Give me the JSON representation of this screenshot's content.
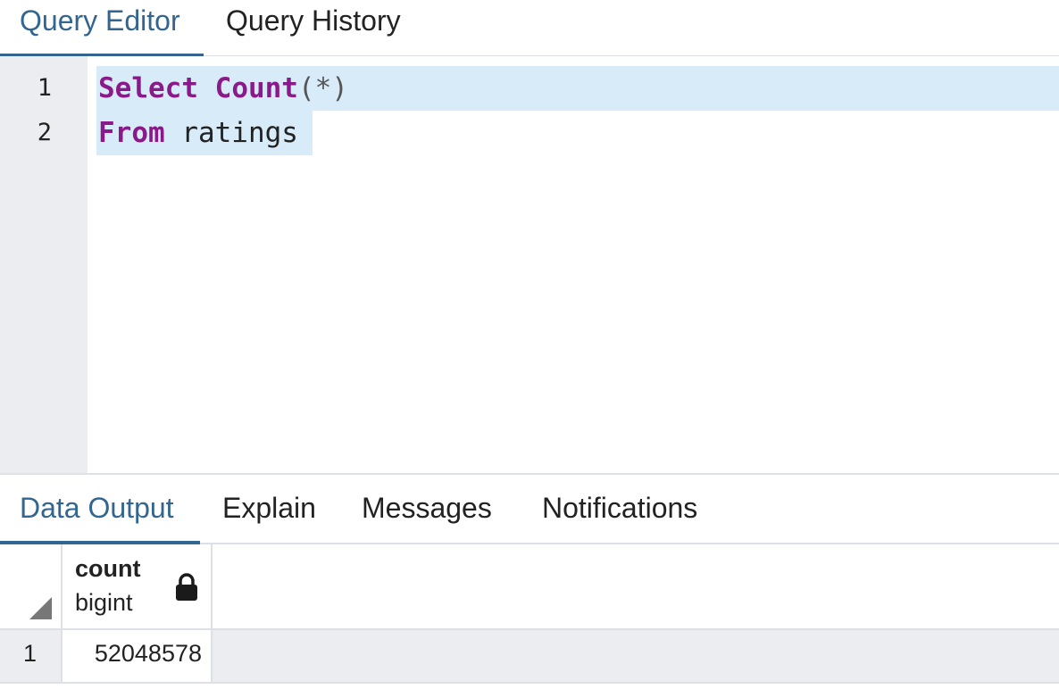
{
  "top_tabs": [
    {
      "label": "Query Editor",
      "active": true
    },
    {
      "label": "Query History",
      "active": false
    }
  ],
  "editor": {
    "line_numbers": [
      "1",
      "2"
    ],
    "lines": [
      {
        "keyword": "Select",
        "function": "Count",
        "args": "(*)"
      },
      {
        "keyword": "From",
        "text": " ratings"
      }
    ]
  },
  "bottom_tabs": [
    {
      "label": "Data Output",
      "active": true
    },
    {
      "label": "Explain",
      "active": false
    },
    {
      "label": "Messages",
      "active": false
    },
    {
      "label": "Notifications",
      "active": false
    }
  ],
  "result_grid": {
    "columns": [
      {
        "name": "count",
        "type": "bigint",
        "icon": "lock-icon"
      }
    ],
    "rows": [
      {
        "row_number": "1",
        "values": [
          "52048578"
        ]
      }
    ]
  },
  "colors": {
    "accent": "#326690",
    "keyword": "#8a1a8a",
    "selection": "#d8ebf8",
    "gutter": "#ebedf1"
  }
}
